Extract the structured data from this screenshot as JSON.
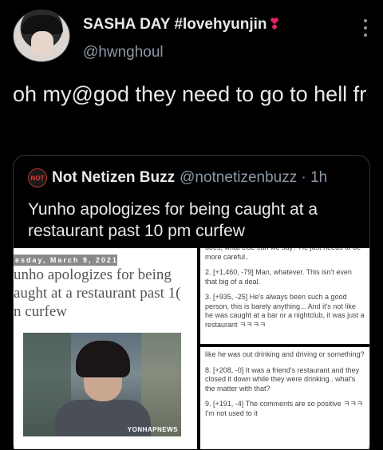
{
  "author": {
    "display_name": "SASHA DAY #lovehyunjin",
    "heart_glyph": "❣",
    "handle": "@hwnghoul"
  },
  "tweet": {
    "text": "oh my@god they need to go to hell fr"
  },
  "quoted": {
    "avatar_text": "NOT",
    "name": "Not Netizen Buzz",
    "handle_time": "@notnetizenbuzz · 1h",
    "text": "Yunho apologizes for being caught at a restaurant past 10 pm curfew"
  },
  "article": {
    "date": "esday, March 9, 2021",
    "title_lines": [
      "unho apologizes for being",
      "aught at a restaurant past 1(",
      "n curfew"
    ],
    "watermark": "YONHAPNEWS"
  },
  "comments_top": [
    "does, what else can we say? He just needs to be more careful..",
    "2. [+1,460, -79] Man, whatever. This isn't even that big of a deal.",
    "3. [+935, -25] He's always been such a good person, this is barely anything... And it's not like he was caught at a bar or a nightclub, it was just a restaurant ㅋㅋㅋㅋ"
  ],
  "comments_bottom": [
    "like he was out drinking and driving or something?",
    "8. [+208, -0] It was a friend's restaurant and they closed it down while they were drinking.. what's the matter with that?",
    "9. [+191, -4] The comments are so positive ㅋㅋㅋ I'm not used to it"
  ]
}
